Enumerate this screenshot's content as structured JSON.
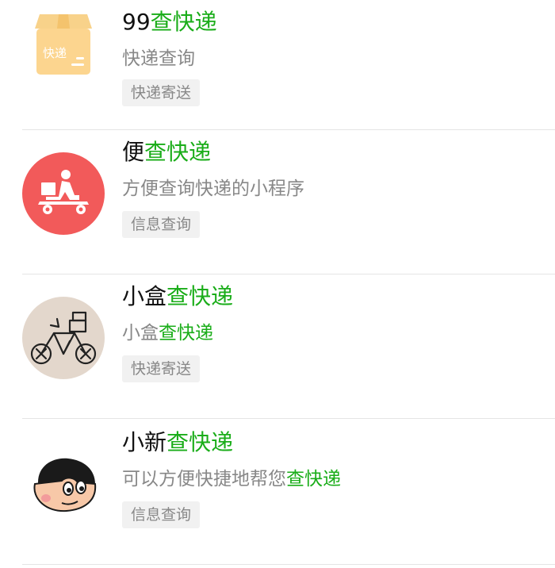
{
  "results": [
    {
      "title_plain": "99",
      "title_highlight": "查快递",
      "desc_plain": "快递查询",
      "desc_highlight": "",
      "tag": "快递寄送",
      "icon": "package-box-icon",
      "icon_text": "快递"
    },
    {
      "title_plain": "便",
      "title_highlight": "查快递",
      "desc_plain": "方便查询快递的小程序",
      "desc_highlight": "",
      "tag": "信息查询",
      "icon": "delivery-scooter-icon",
      "icon_color": "#f25a5a"
    },
    {
      "title_plain": "小盒",
      "title_highlight": "查快递",
      "desc_plain": "小盒",
      "desc_highlight": "查快递",
      "tag": "快递寄送",
      "icon": "bicycle-sketch-icon"
    },
    {
      "title_plain": "小新",
      "title_highlight": "查快递",
      "desc_plain": "可以方便快捷地帮您",
      "desc_highlight": "查快递",
      "tag": "信息查询",
      "icon": "cartoon-face-icon"
    }
  ],
  "colors": {
    "highlight": "#1aad19",
    "text": "#111111",
    "muted": "#888888",
    "tag_bg": "#f1f1f1"
  }
}
